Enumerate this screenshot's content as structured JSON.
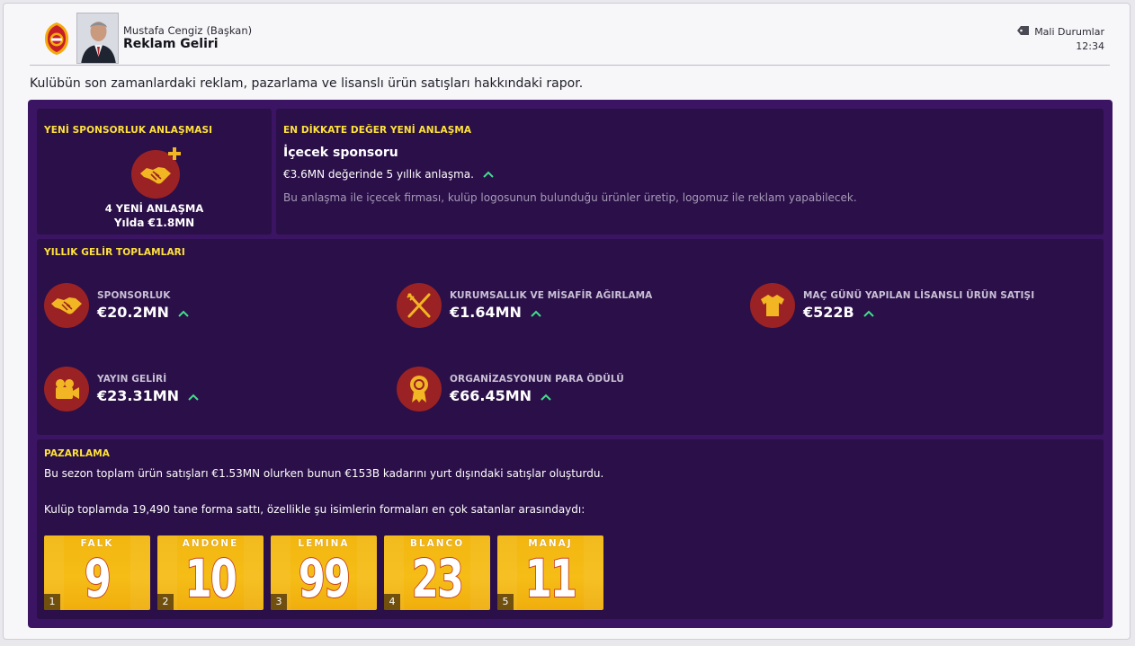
{
  "header": {
    "sender_name": "Mustafa Cengiz",
    "sender_role": "(Başkan)",
    "title": "Reklam Geliri",
    "tag": "Mali Durumlar",
    "time": "12:34"
  },
  "intro": "Kulübün son zamanlardaki reklam, pazarlama ve lisanslı ürün satışları hakkındaki rapor.",
  "new_sponsorship": {
    "title": "YENİ SPONSORLUK ANLAŞMASI",
    "icon": "handshake-plus-icon",
    "deals": "4 YENİ ANLAŞMA",
    "per_year": "Yılda €1.8MN"
  },
  "notable_deal": {
    "title": "EN DİKKATE DEĞER YENİ ANLAŞMA",
    "name": "İçecek sponsoru",
    "description": "€3.6MN değerinde 5 yıllık anlaşma.",
    "note": "Bu anlaşma ile içecek firması, kulüp logosunun bulunduğu ürünler üretip, logomuz ile reklam yapabilecek."
  },
  "annual_revenue": {
    "title": "YILLIK GELİR TOPLAMLARI",
    "items": [
      {
        "label": "SPONSORLUK",
        "value": "€20.2MN",
        "icon": "handshake-icon",
        "trend": "up"
      },
      {
        "label": "KURUMSALLIK VE MİSAFİR AĞIRLAMA",
        "value": "€1.64MN",
        "icon": "fork-knife-icon",
        "trend": "up"
      },
      {
        "label": "MAÇ GÜNÜ YAPILAN LİSANSLI ÜRÜN SATIŞI",
        "value": "€522B",
        "icon": "shirt-icon",
        "trend": "up"
      },
      {
        "label": "YAYIN GELİRİ",
        "value": "€23.31MN",
        "icon": "video-camera-icon",
        "trend": "up"
      },
      {
        "label": "ORGANİZASYONUN PARA ÖDÜLÜ",
        "value": "€66.45MN",
        "icon": "medal-icon",
        "trend": "up"
      }
    ]
  },
  "marketing": {
    "title": "PAZARLAMA",
    "text1": "Bu sezon toplam ürün satışları €1.53MN olurken bunun €153B kadarını yurt dışındaki satışlar oluşturdu.",
    "text2": "Kulüp toplamda 19,490 tane forma sattı, özellikle şu isimlerin formaları en çok satanlar arasındaydı:",
    "shirts": [
      {
        "name": "FALK",
        "number": "9",
        "rank": "1"
      },
      {
        "name": "ANDONE",
        "number": "10",
        "rank": "2"
      },
      {
        "name": "LEMINA",
        "number": "99",
        "rank": "3"
      },
      {
        "name": "BLANCO",
        "number": "23",
        "rank": "4"
      },
      {
        "name": "MANAJ",
        "number": "11",
        "rank": "5"
      }
    ]
  },
  "colors": {
    "panel": "#3b1563",
    "box": "#2a0f48",
    "accent_yellow": "#ffe23a",
    "icon_red": "#9a2224",
    "trend_green": "#3ee08a",
    "shirt_yellow": "#f6bd17"
  }
}
